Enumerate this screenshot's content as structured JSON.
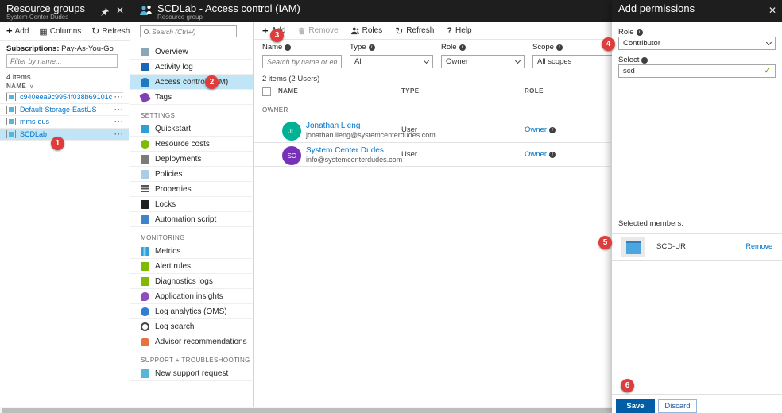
{
  "colors": {
    "accent_blue": "#0072c6",
    "highlight_blue": "#bfe5f6",
    "badge_red": "#de3d3c",
    "save_blue": "#005da6",
    "check_green": "#5db300"
  },
  "step_badges": [
    "1",
    "2",
    "3",
    "4",
    "5",
    "6"
  ],
  "resource_groups": {
    "title": "Resource groups",
    "subtitle": "System Center Dudes",
    "toolbar": {
      "add": "Add",
      "columns": "Columns",
      "refresh": "Refresh"
    },
    "subscriptions_label": "Subscriptions:",
    "subscriptions_value": "Pay-As-You-Go",
    "filter_placeholder": "Filter by name...",
    "items_count": "4 items",
    "name_header": "NAME",
    "menu_ellipsis": "···",
    "rows": [
      {
        "name": "c940eea9c9954f038b69101c"
      },
      {
        "name": "Default-Storage-EastUS"
      },
      {
        "name": "mms-eus"
      },
      {
        "name": "SCDLab",
        "selected": true
      }
    ]
  },
  "blade": {
    "title": "SCDLab - Access control (IAM)",
    "subtitle": "Resource group",
    "search_placeholder": "Search (Ctrl+/)",
    "menu_sections": [
      {
        "label": "",
        "items": [
          {
            "label": "Overview",
            "icon": "overview-icon"
          },
          {
            "label": "Activity log",
            "icon": "activity-log-icon"
          },
          {
            "label": "Access control (IAM)",
            "icon": "access-control-icon",
            "active": true
          },
          {
            "label": "Tags",
            "icon": "tags-icon"
          }
        ]
      },
      {
        "label": "SETTINGS",
        "items": [
          {
            "label": "Quickstart",
            "icon": "quickstart-icon"
          },
          {
            "label": "Resource costs",
            "icon": "resource-costs-icon"
          },
          {
            "label": "Deployments",
            "icon": "deployments-icon"
          },
          {
            "label": "Policies",
            "icon": "policies-icon"
          },
          {
            "label": "Properties",
            "icon": "properties-icon"
          },
          {
            "label": "Locks",
            "icon": "locks-icon"
          },
          {
            "label": "Automation script",
            "icon": "automation-script-icon"
          }
        ]
      },
      {
        "label": "MONITORING",
        "items": [
          {
            "label": "Metrics",
            "icon": "metrics-icon"
          },
          {
            "label": "Alert rules",
            "icon": "alert-rules-icon"
          },
          {
            "label": "Diagnostics logs",
            "icon": "diagnostics-logs-icon"
          },
          {
            "label": "Application insights",
            "icon": "application-insights-icon"
          },
          {
            "label": "Log analytics (OMS)",
            "icon": "log-analytics-icon"
          },
          {
            "label": "Log search",
            "icon": "log-search-icon"
          },
          {
            "label": "Advisor recommendations",
            "icon": "advisor-icon"
          }
        ]
      },
      {
        "label": "SUPPORT + TROUBLESHOOTING",
        "items": [
          {
            "label": "New support request",
            "icon": "support-request-icon"
          }
        ]
      }
    ]
  },
  "main": {
    "toolbar": {
      "add": "Add",
      "remove": "Remove",
      "roles": "Roles",
      "refresh": "Refresh",
      "help": "Help"
    },
    "filters": {
      "name_label": "Name",
      "name_placeholder": "Search by name or email",
      "type_label": "Type",
      "type_value": "All",
      "role_label": "Role",
      "role_value": "Owner",
      "scope_label": "Scope",
      "scope_value": "All scopes"
    },
    "items_summary": "2 items (2 Users)",
    "table": {
      "headers": {
        "name": "NAME",
        "type": "TYPE",
        "role": "ROLE"
      },
      "group_label": "OWNER",
      "rows": [
        {
          "initials": "JL",
          "avatar_color": "#00b294",
          "name": "Jonathan Lieng",
          "email": "jonathan.lieng@systemcenterdudes.com",
          "type": "User",
          "role": "Owner"
        },
        {
          "initials": "SC",
          "avatar_color": "#7633b8",
          "name": "System Center Dudes",
          "email": "info@systemcenterdudes.com",
          "type": "User",
          "role": "Owner"
        }
      ]
    }
  },
  "add_permissions": {
    "title": "Add permissions",
    "role_label": "Role",
    "role_value": "Contributor",
    "select_label": "Select",
    "select_value": "scd",
    "selected_members_label": "Selected members:",
    "members": [
      {
        "name": "SCD-UR",
        "remove_label": "Remove"
      }
    ],
    "save_label": "Save",
    "discard_label": "Discard"
  }
}
